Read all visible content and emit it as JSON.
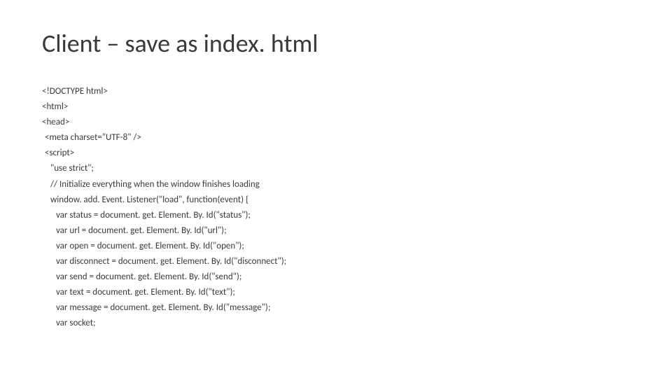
{
  "title": "Client – save as index. html",
  "code": {
    "lines": [
      {
        "text": "<!DOCTYPE html>",
        "indent": 0
      },
      {
        "text": "<html>",
        "indent": 0
      },
      {
        "text": "<head>",
        "indent": 0
      },
      {
        "text": "<meta charset=\"UTF-8\" />",
        "indent": 1
      },
      {
        "text": "<script>",
        "indent": 1
      },
      {
        "text": "\"use strict\";",
        "indent": 2
      },
      {
        "text": "// Initialize everything when the window finishes loading",
        "indent": 2
      },
      {
        "text": "window. add. Event. Listener(\"load\", function(event) {",
        "indent": 2
      },
      {
        "text": "var status = document. get. Element. By. Id(\"status\");",
        "indent": 3
      },
      {
        "text": "var url = document. get. Element. By. Id(\"url\");",
        "indent": 3
      },
      {
        "text": "var open = document. get. Element. By. Id(\"open\");",
        "indent": 3
      },
      {
        "text": "var disconnect = document. get. Element. By. Id(\"disconnect\");",
        "indent": 3
      },
      {
        "text": "var send = document. get. Element. By. Id(\"send\");",
        "indent": 3
      },
      {
        "text": "var text = document. get. Element. By. Id(\"text\");",
        "indent": 3
      },
      {
        "text": "var message = document. get. Element. By. Id(\"message\");",
        "indent": 3
      },
      {
        "text": "var socket;",
        "indent": 3
      }
    ]
  }
}
